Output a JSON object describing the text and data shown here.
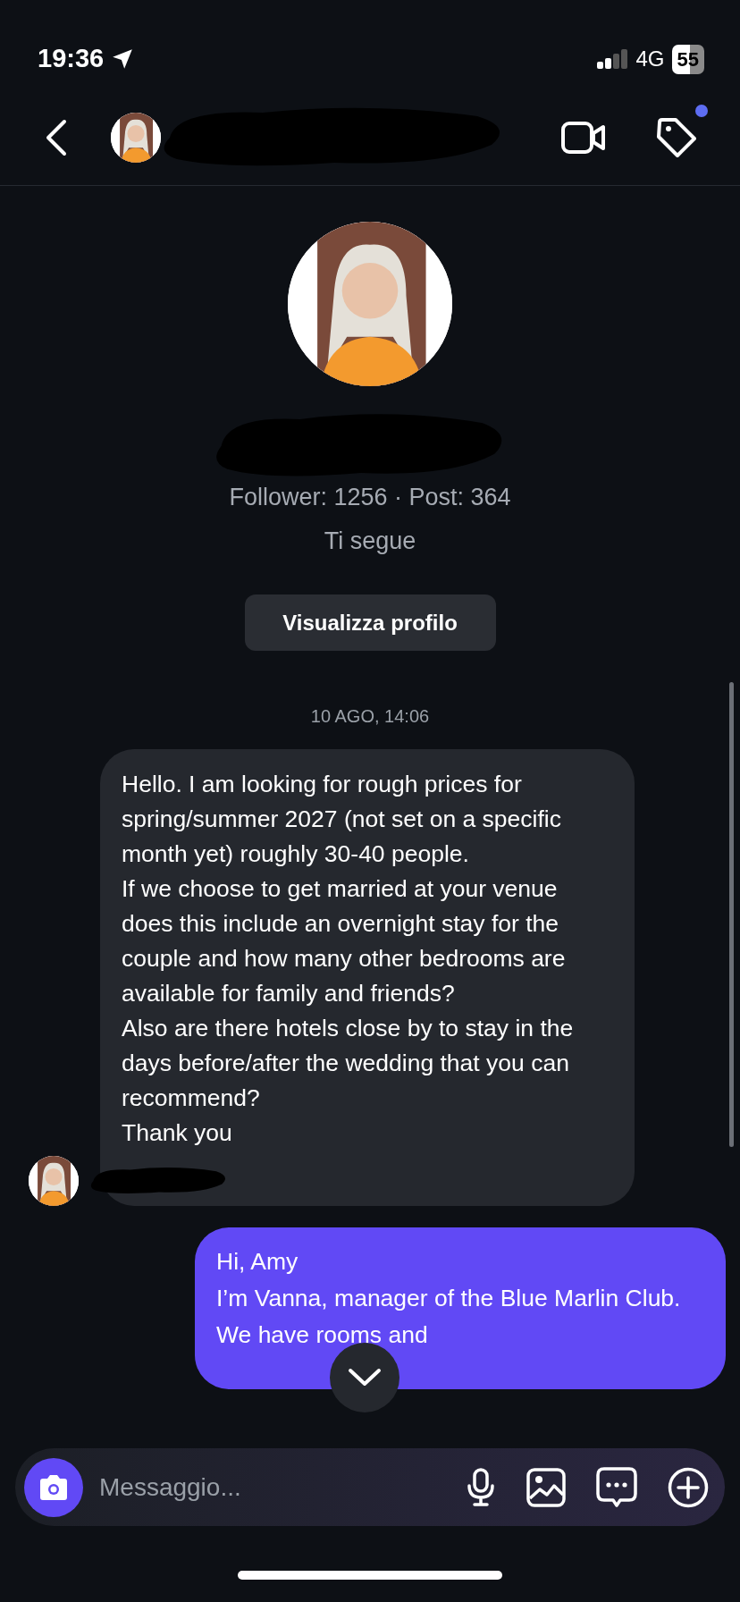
{
  "status_bar": {
    "time": "19:36",
    "network": "4G",
    "battery": "55"
  },
  "header": {
    "tag_badge": true
  },
  "profile": {
    "stats": "Follower: 1256 · Post: 364",
    "follow_status": "Ti segue",
    "button": "Visualizza profilo"
  },
  "thread": {
    "date": "10 AGO, 14:06",
    "messages": [
      {
        "kind": "incoming",
        "paragraphs": [
          "Hello. I am looking for rough prices for spring/summer 2027 (not set on a specific month yet) roughly 30-40 people.",
          "If we choose to get married at your venue does this include an overnight stay for the couple and how many other bedrooms are available for family and friends?",
          "Also are there hotels close by to stay in the days before/after the wedding that you can recommend?",
          "Thank you"
        ]
      },
      {
        "kind": "outgoing",
        "paragraphs": [
          "Hi, Amy",
          "I’m Vanna, manager of the Blue Marlin Club. We have rooms and"
        ]
      }
    ]
  },
  "composer": {
    "placeholder": "Messaggio..."
  }
}
